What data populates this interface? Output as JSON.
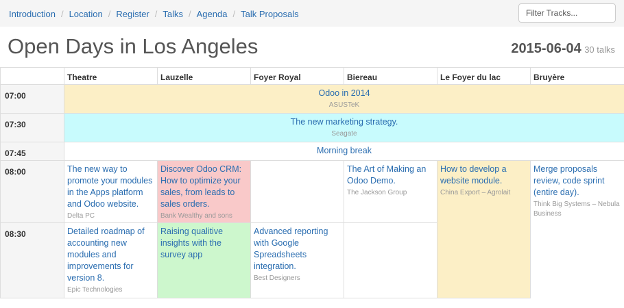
{
  "nav": {
    "breadcrumbs": [
      "Introduction",
      "Location",
      "Register",
      "Talks",
      "Agenda",
      "Talk Proposals"
    ],
    "filter_placeholder": "Filter Tracks..."
  },
  "page": {
    "title": "Open Days in Los Angeles",
    "date": "2015-06-04",
    "talk_count": "30 talks"
  },
  "agenda": {
    "rooms": [
      "Theatre",
      "Lauzelle",
      "Foyer Royal",
      "Biereau",
      "Le Foyer du lac",
      "Bruyère"
    ],
    "times": [
      "07:00",
      "07:30",
      "07:45",
      "08:00",
      "08:30"
    ],
    "events": {
      "odoo2014": {
        "title": "Odoo in 2014",
        "speaker": "ASUSTeK"
      },
      "marketing": {
        "title": "The new marketing strategy.",
        "speaker": "Seagate"
      },
      "break": {
        "title": "Morning break"
      },
      "apps": {
        "title": "The new way to promote your modules in the Apps platform and Odoo website.",
        "speaker": "Delta PC"
      },
      "crm": {
        "title": "Discover Odoo CRM: How to optimize your sales, from leads to sales orders.",
        "speaker": "Bank Wealthy and sons"
      },
      "demo": {
        "title": "The Art of Making an Odoo Demo.",
        "speaker": "The Jackson Group"
      },
      "website": {
        "title": "How to develop a website module.",
        "speaker": "China Export – Agrolait"
      },
      "merge": {
        "title": "Merge proposals review, code sprint (entire day).",
        "speaker": "Think Big Systems – Nebula Business"
      },
      "roadmap": {
        "title": "Detailed roadmap of accounting new modules and improvements for version 8.",
        "speaker": "Epic Technologies"
      },
      "survey": {
        "title": "Raising qualitive insights with the survey app"
      },
      "reporting": {
        "title": "Advanced reporting with Google Spreadsheets integration.",
        "speaker": "Best Designers"
      }
    }
  },
  "colors": {
    "link": "#2a6db0",
    "yellow": "#fcefc6",
    "cyan": "#c8fbfd",
    "pink": "#f9c9c9",
    "green": "#cdf7cd"
  }
}
